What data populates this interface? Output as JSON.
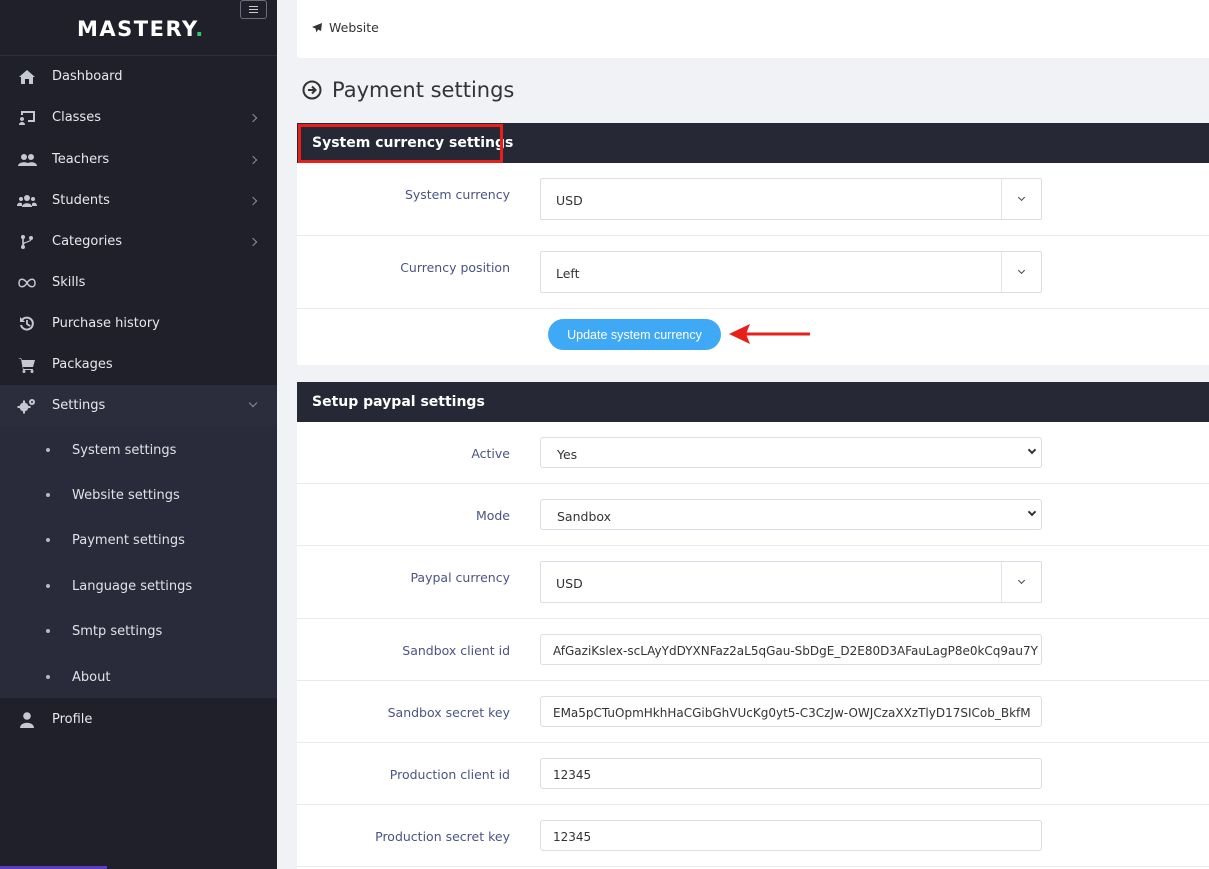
{
  "app": {
    "logo": "MASTERY",
    "logo_dot": "."
  },
  "sidebar": {
    "items": [
      {
        "label": "Dashboard",
        "icon": "home-icon"
      },
      {
        "label": "Classes",
        "icon": "chalkboard-icon"
      },
      {
        "label": "Teachers",
        "icon": "users-icon"
      },
      {
        "label": "Students",
        "icon": "user-group-icon"
      },
      {
        "label": "Categories",
        "icon": "branch-icon"
      },
      {
        "label": "Skills",
        "icon": "infinity-icon"
      },
      {
        "label": "Purchase history",
        "icon": "history-icon"
      },
      {
        "label": "Packages",
        "icon": "cart-icon"
      },
      {
        "label": "Settings",
        "icon": "gears-icon"
      },
      {
        "label": "Profile",
        "icon": "user-icon"
      }
    ],
    "settings_sub": [
      "System settings",
      "Website settings",
      "Payment settings",
      "Language settings",
      "Smtp settings",
      "About"
    ]
  },
  "topbar": {
    "website_link": "Website"
  },
  "page": {
    "title": "Payment settings"
  },
  "currency_card": {
    "title": "System currency settings",
    "system_currency_label": "System currency",
    "system_currency_value": "USD",
    "currency_position_label": "Currency position",
    "currency_position_value": "Left",
    "update_button": "Update system currency"
  },
  "paypal_card": {
    "title": "Setup paypal settings",
    "active_label": "Active",
    "active_value": "Yes",
    "mode_label": "Mode",
    "mode_value": "Sandbox",
    "currency_label": "Paypal currency",
    "currency_value": "USD",
    "sandbox_client_id_label": "Sandbox client id",
    "sandbox_client_id_value": "AfGaziKslex-scLAyYdDYXNFaz2aL5qGau-SbDgE_D2E80D3AFauLagP8e0kCq9au7Y",
    "sandbox_secret_key_label": "Sandbox secret key",
    "sandbox_secret_key_value": "EMa5pCTuOpmHkhHaCGibGhVUcKg0yt5-C3CzJw-OWJCzaXXzTlyD17SICob_BkfM",
    "production_client_id_label": "Production client id",
    "production_client_id_value": "12345",
    "production_secret_key_label": "Production secret key",
    "production_secret_key_value": "12345"
  },
  "colors": {
    "sidebar_bg": "#1f2029",
    "accent_button": "#3fa9f5",
    "highlight": "#e8201a"
  }
}
